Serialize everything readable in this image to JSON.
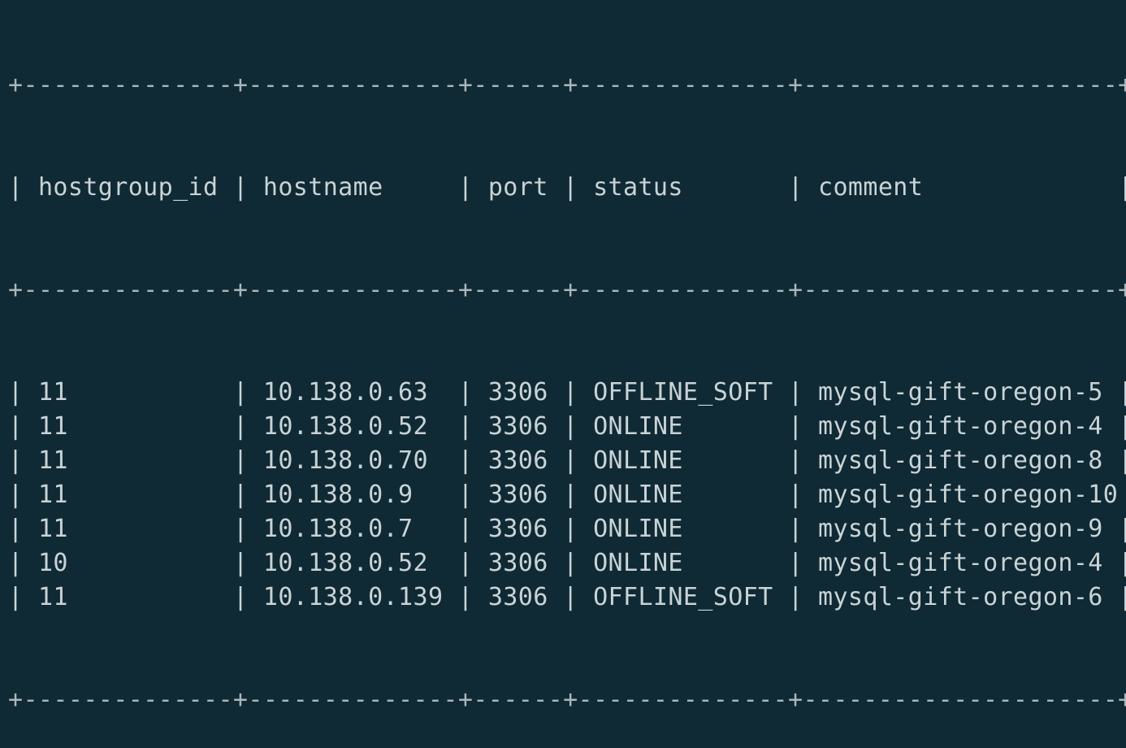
{
  "terminal": {
    "separator": "+--------------+--------------+------+--------------+---------------------+",
    "columns": [
      "hostgroup_id",
      "hostname",
      "port",
      "status",
      "comment"
    ],
    "rows": [
      [
        "11",
        "10.138.0.63",
        "3306",
        "OFFLINE_SOFT",
        "mysql-gift-oregon-5"
      ],
      [
        "11",
        "10.138.0.52",
        "3306",
        "ONLINE",
        "mysql-gift-oregon-4"
      ],
      [
        "11",
        "10.138.0.70",
        "3306",
        "ONLINE",
        "mysql-gift-oregon-8"
      ],
      [
        "11",
        "10.138.0.9",
        "3306",
        "ONLINE",
        "mysql-gift-oregon-10"
      ],
      [
        "11",
        "10.138.0.7",
        "3306",
        "ONLINE",
        "mysql-gift-oregon-9"
      ],
      [
        "10",
        "10.138.0.52",
        "3306",
        "ONLINE",
        "mysql-gift-oregon-4"
      ],
      [
        "11",
        "10.138.0.139",
        "3306",
        "OFFLINE_SOFT",
        "mysql-gift-oregon-6"
      ]
    ]
  },
  "colors": {
    "background": "#0f2a34",
    "text": "#c9d3d6"
  }
}
